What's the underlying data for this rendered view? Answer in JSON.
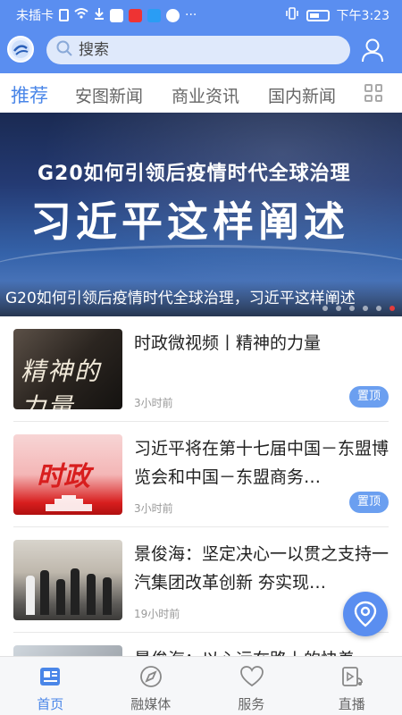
{
  "status_bar": {
    "carrier": "未插卡",
    "more": "···",
    "time": "下午3:23"
  },
  "header": {
    "search_placeholder": "搜索",
    "logo_icon": "app-logo",
    "user_icon": "user-icon"
  },
  "tabs": [
    {
      "label": "推荐",
      "active": true
    },
    {
      "label": "安图新闻",
      "active": false
    },
    {
      "label": "商业资讯",
      "active": false
    },
    {
      "label": "国内新闻",
      "active": false
    }
  ],
  "banner": {
    "headline_line1": "G20如何引领后疫情时代全球治理",
    "headline_line2": "习近平这样阐述",
    "caption": "G20如何引领后疫情时代全球治理，习近平这样阐述",
    "slide_count": 6,
    "active_slide": 6
  },
  "news": [
    {
      "thumb_text": "精神的力量",
      "title": "时政微视频丨精神的力量",
      "time": "3小时前",
      "badge": "置顶"
    },
    {
      "thumb_text": "时政",
      "title": "习近平将在第十七届中国－东盟博览会和中国－东盟商务…",
      "time": "3小时前",
      "badge": "置顶"
    },
    {
      "thumb_text": "",
      "title": "景俊海：坚定决心一以贯之支持一汽集团改革创新 夯实现…",
      "time": "19小时前",
      "badge": ""
    },
    {
      "thumb_text": "",
      "title": "景俊海：以心运在路上的快着",
      "time": "",
      "badge": ""
    }
  ],
  "bottom_nav": [
    {
      "label": "首页",
      "icon": "home-news-icon",
      "active": true
    },
    {
      "label": "融媒体",
      "icon": "media-compass-icon",
      "active": false
    },
    {
      "label": "服务",
      "icon": "heart-service-icon",
      "active": false
    },
    {
      "label": "直播",
      "icon": "live-video-icon",
      "active": false
    }
  ],
  "colors": {
    "accent": "#5a8ef0",
    "tab_active": "#4a86e8",
    "badge": "#6b9ff0"
  }
}
